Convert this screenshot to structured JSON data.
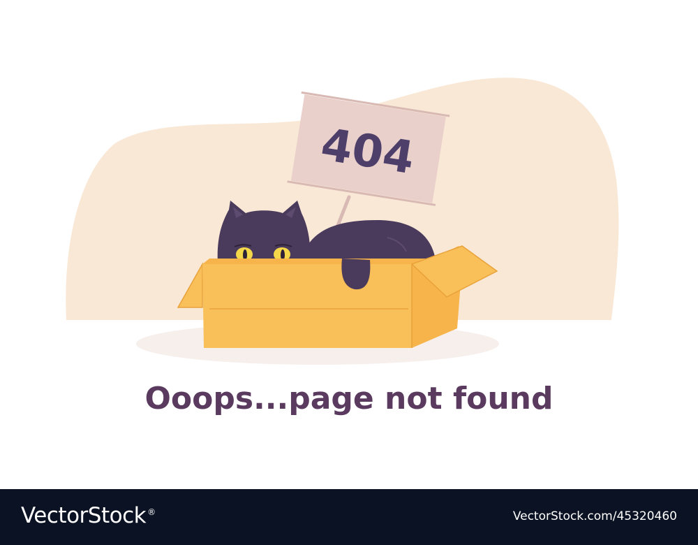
{
  "illustration": {
    "sign_text": "404",
    "colors": {
      "backdrop_blob": "#f9e8d6",
      "floor_shadow": "#f6efec",
      "box_front": "#f9c05a",
      "box_flap": "#f7b44b",
      "box_line": "#e9a23a",
      "cat_body": "#4a3a5c",
      "cat_eye": "#f5d84a",
      "sign_board": "#ead0cb",
      "sign_stick": "#d8b9b3"
    }
  },
  "headline": "Ooops...page not found",
  "footer": {
    "brand": "VectorStock",
    "brand_mark": "®",
    "image_id": "VectorStock.com/45320460"
  }
}
